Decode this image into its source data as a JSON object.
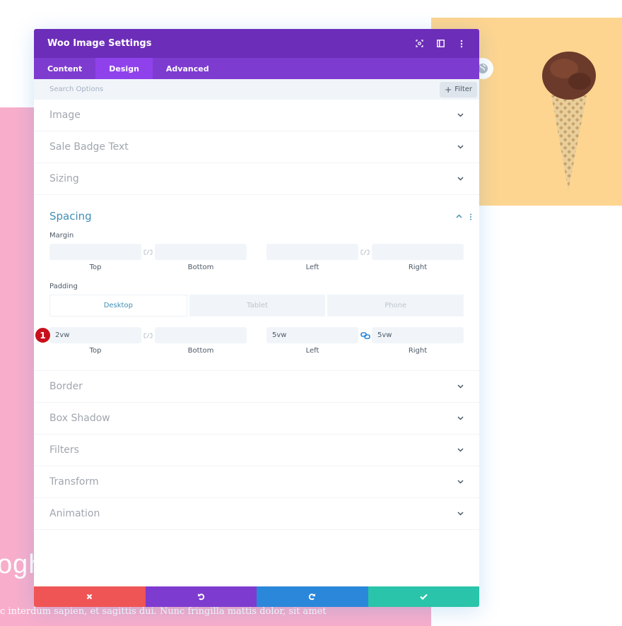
{
  "background": {
    "heading_fragment": "ogh",
    "paragraph_fragment": "c interdum sapien, et sagittis dui. Nunc fringilla mattis dolor, sit amet",
    "colors": {
      "pink": "#f8aecb",
      "yellow": "#fed590"
    }
  },
  "modal": {
    "title": "Woo Image Settings",
    "header_icons": [
      "expand-icon",
      "sidebar-layout-icon",
      "more-vertical-icon"
    ],
    "tabs": [
      {
        "label": "Content",
        "active": false
      },
      {
        "label": "Design",
        "active": true
      },
      {
        "label": "Advanced",
        "active": false
      }
    ],
    "search": {
      "placeholder": "Search Options",
      "value": ""
    },
    "filter_label": "Filter",
    "sections_before": [
      {
        "label": "Image"
      },
      {
        "label": "Sale Badge Text"
      },
      {
        "label": "Sizing"
      }
    ],
    "spacing": {
      "title": "Spacing",
      "margin": {
        "label": "Margin",
        "fields": [
          {
            "label": "Top",
            "value": ""
          },
          {
            "label": "Bottom",
            "value": ""
          },
          {
            "label": "Left",
            "value": ""
          },
          {
            "label": "Right",
            "value": ""
          }
        ],
        "linked_vertical": false,
        "linked_horizontal": false
      },
      "padding": {
        "label": "Padding",
        "devices": [
          {
            "label": "Desktop",
            "active": true
          },
          {
            "label": "Tablet",
            "active": false
          },
          {
            "label": "Phone",
            "active": false
          }
        ],
        "fields": [
          {
            "label": "Top",
            "value": "2vw"
          },
          {
            "label": "Bottom",
            "value": ""
          },
          {
            "label": "Left",
            "value": "5vw"
          },
          {
            "label": "Right",
            "value": "5vw"
          }
        ],
        "linked_vertical": false,
        "linked_horizontal": true
      },
      "step_badge": "1"
    },
    "sections_after": [
      {
        "label": "Border"
      },
      {
        "label": "Box Shadow"
      },
      {
        "label": "Filters"
      },
      {
        "label": "Transform"
      },
      {
        "label": "Animation"
      }
    ],
    "footer": {
      "buttons": [
        "cancel",
        "undo",
        "redo",
        "save"
      ],
      "colors": {
        "cancel": "#ef5555",
        "undo": "#7e3bd0",
        "redo": "#2b87da",
        "save": "#29c4a9"
      }
    },
    "colors": {
      "header": "#6c2eb9",
      "tabs": "#7e3bd0",
      "active_tab": "#8f42ec",
      "accent": "#3f8fb5"
    }
  }
}
